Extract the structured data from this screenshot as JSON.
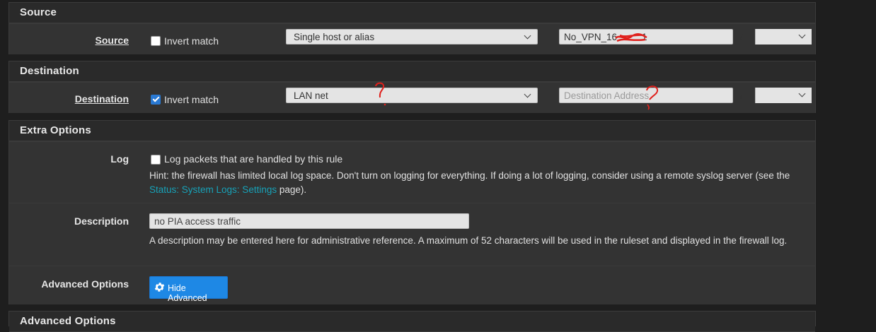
{
  "source_section": {
    "title": "Source",
    "label": "Source",
    "invert_label": "Invert match",
    "invert_checked": false,
    "type_select": "Single host or alias",
    "address_value": "No_VPN_16",
    "address_tail": "1",
    "slash": "/"
  },
  "destination_section": {
    "title": "Destination",
    "label": "Destination",
    "invert_label": "Invert match",
    "invert_checked": true,
    "type_select": "LAN net",
    "address_placeholder": "Destination Address",
    "slash": "/"
  },
  "extra_options": {
    "title": "Extra Options",
    "log": {
      "label": "Log",
      "checkbox_label": "Log packets that are handled by this rule",
      "checked": false,
      "hint_text": "Hint: the firewall has limited local log space. Don't turn on logging for everything. If doing a lot of logging, consider using a remote syslog server (see the ",
      "hint_link": "Status: System Logs: Settings",
      "hint_suffix": " page)."
    },
    "description": {
      "label": "Description",
      "value": "no PIA access traffic",
      "help": "A description may be entered here for administrative reference. A maximum of 52 characters will be used in the ruleset and displayed in the firewall log."
    },
    "advanced": {
      "label": "Advanced Options",
      "button_label": "Hide Advanced",
      "button_icon": "gear-icon"
    }
  },
  "next_section_title": "Advanced Options",
  "colors": {
    "accent_button": "#1e88e5",
    "link": "#17a2b8",
    "annotation": "#e0201c"
  }
}
